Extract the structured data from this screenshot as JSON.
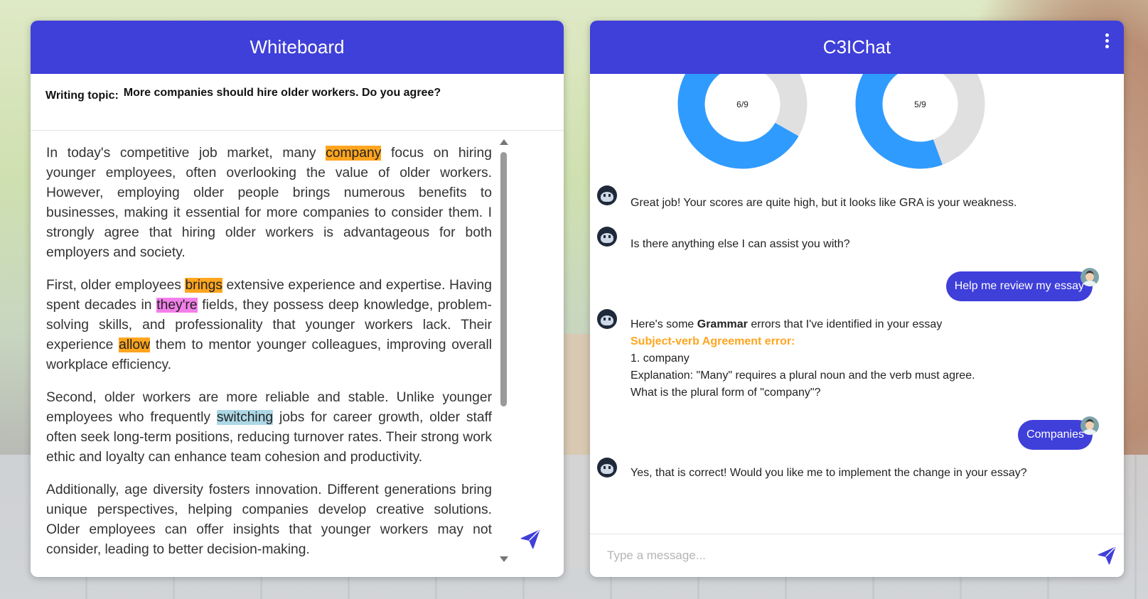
{
  "whiteboard": {
    "title": "Whiteboard",
    "topic_label": "Writing topic:",
    "topic_text": "More companies should hire older workers. Do you agree?",
    "p1": {
      "a": "In today's competitive job market, many ",
      "hl1": "company",
      "b": " focus on hiring younger employees, often overlooking the value of older workers. However, employing older people brings numerous benefits to businesses, making it essential for more companies to consider them. I strongly agree that hiring older workers is advantageous for both employers and society."
    },
    "p2": {
      "a": "First, older employees ",
      "hl1": "brings",
      "b": " extensive experience and expertise. Having spent decades in ",
      "hl2": "they're",
      "c": " fields, they possess deep knowledge, problem-solving skills, and professionality that younger workers lack. Their experience ",
      "hl3": "allow",
      "d": " them to mentor younger colleagues, improving overall workplace efficiency."
    },
    "p3": {
      "a": "Second, older workers are more reliable and stable. Unlike younger employees who frequently ",
      "hl1": "switching",
      "b": " jobs for career growth, older staff often seek long-term positions, reducing turnover rates. Their strong work ethic and loyalty can enhance team cohesion and productivity."
    },
    "p4": "Additionally, age diversity fosters innovation. Different generations bring unique perspectives, helping companies develop creative solutions. Older employees can offer insights that younger workers may not consider, leading to better decision-making.",
    "colors": {
      "highlight_orange": "#ffa51f",
      "highlight_pink": "#f27fe9",
      "highlight_blue": "#acd8e6"
    }
  },
  "chat": {
    "title": "C3IChat",
    "score1": "6/9",
    "score1_fraction": 0.667,
    "score2": "5/9",
    "score2_fraction": 0.556,
    "msg1": "Great job! Your scores are quite high, but it looks like GRA is your weakness.",
    "msg2": "Is there anything else I can assist you with?",
    "user1": "Help me review my essay",
    "msg3_a": "Here's some ",
    "msg3_b": "Grammar",
    "msg3_c": " errors that I've identified in your essay",
    "msg3_err": "Subject-verb Agreement error:",
    "msg3_item": "1. company",
    "msg3_expl": "Explanation: \"Many\" requires a plural noun and the verb must agree.",
    "msg3_q": "What is the plural form of \"company\"?",
    "user2": "Companies",
    "msg4": "Yes, that is correct! Would you like me to implement the change in your essay?",
    "input_placeholder": "Type a message...",
    "colors": {
      "accent": "#3f3fd9",
      "donut_fill": "#2f9bff",
      "donut_track": "#e0e0e0"
    }
  }
}
